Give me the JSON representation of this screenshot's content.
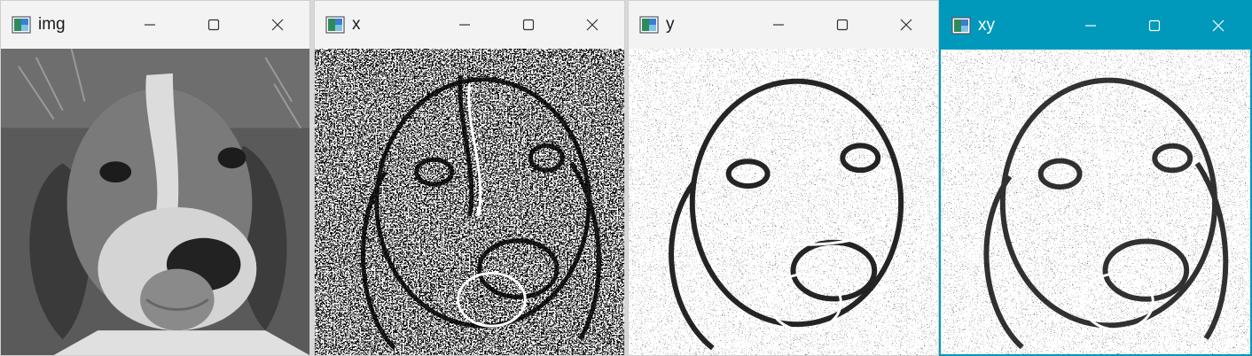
{
  "windows": [
    {
      "title": "img",
      "active": false,
      "image": "grayscale-beagle-puppy"
    },
    {
      "title": "x",
      "active": false,
      "image": "sobel-x-edges-beagle"
    },
    {
      "title": "y",
      "active": false,
      "image": "sobel-y-edges-beagle"
    },
    {
      "title": "xy",
      "active": true,
      "image": "sobel-xy-edges-beagle"
    }
  ],
  "colors": {
    "active_titlebar": "#0099bc",
    "inactive_titlebar": "#f3f3f3"
  },
  "icons": {
    "app": "image-window-icon",
    "minimize": "minimize-icon",
    "maximize": "maximize-icon",
    "close": "close-icon"
  }
}
